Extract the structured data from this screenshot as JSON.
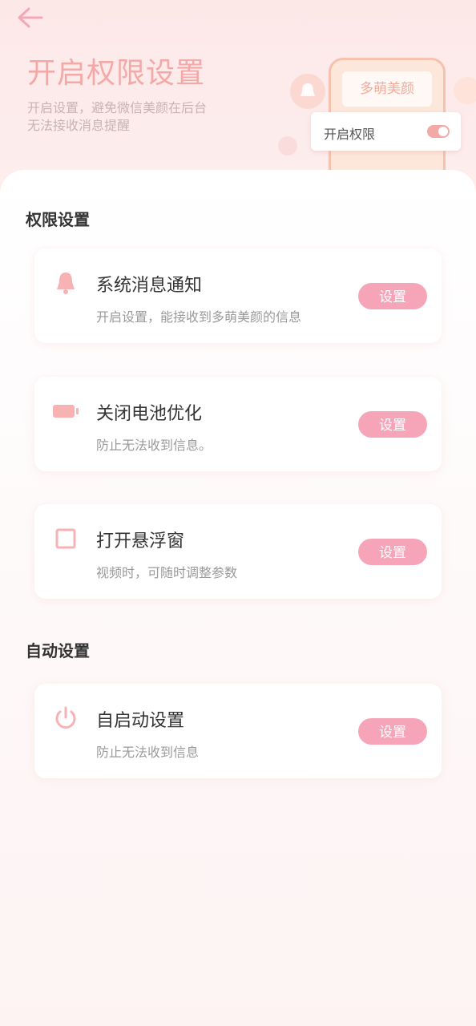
{
  "header": {
    "title": "开启权限设置",
    "subtitle": "开启设置，避免微信美颜在后台无法接收消息提醒"
  },
  "illustration": {
    "phone_brand": "多萌美颜",
    "permission_label": "开启权限",
    "toggle_on": true
  },
  "sections": [
    {
      "title": "权限设置",
      "items": [
        {
          "icon": "bell-icon",
          "title": "系统消息通知",
          "desc": "开启设置，能接收到多萌美颜的信息",
          "button": "设置"
        },
        {
          "icon": "battery-icon",
          "title": "关闭电池优化",
          "desc": "防止无法收到信息。",
          "button": "设置"
        },
        {
          "icon": "window-icon",
          "title": "打开悬浮窗",
          "desc": "视频时，可随时调整参数",
          "button": "设置"
        }
      ]
    },
    {
      "title": "自动设置",
      "items": [
        {
          "icon": "power-icon",
          "title": "自启动设置",
          "desc": "防止无法收到信息",
          "button": "设置"
        }
      ]
    }
  ],
  "colors": {
    "accent": "#f6a5b9",
    "title_pink": "#f3a9a7",
    "icon_pink": "#f7b2b4"
  }
}
